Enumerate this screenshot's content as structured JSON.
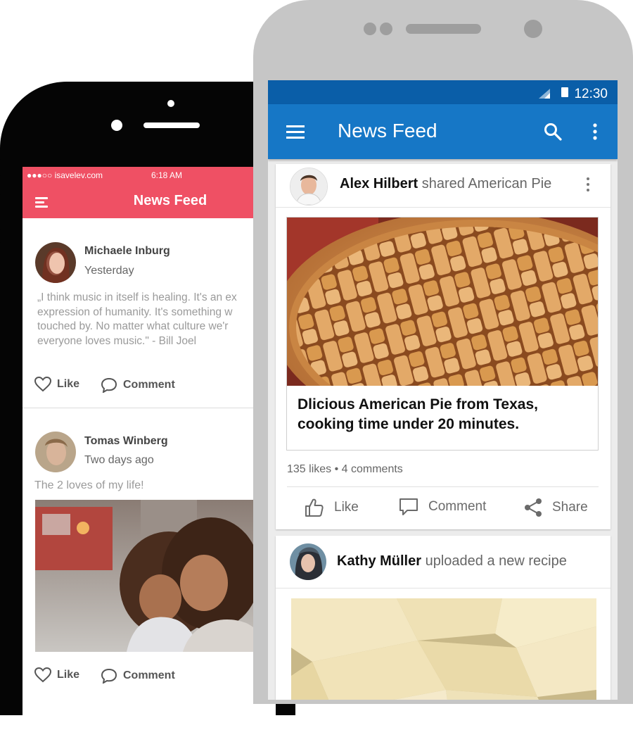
{
  "iphone": {
    "status": {
      "carrier": "●●●○○ isavelev.com",
      "time": "6:18 AM"
    },
    "nav": {
      "title": "News Feed",
      "menu_icon": "hamburger-icon"
    },
    "posts": [
      {
        "author": "Michaele Inburg",
        "time": "Yesterday",
        "text_lines": [
          "„I think music in itself is healing. It's an ex",
          "expression of humanity. It's something w",
          "touched by. No matter what culture we'r",
          "everyone loves music.\" - Bill Joel"
        ],
        "like_label": "Like",
        "comment_label": "Comment"
      },
      {
        "author": "Tomas Winberg",
        "time": "Two days ago",
        "caption": "The 2 loves of my life!",
        "like_label": "Like",
        "comment_label": "Comment"
      }
    ],
    "accent": "#ef5064"
  },
  "android": {
    "status": {
      "time": "12:30"
    },
    "toolbar": {
      "title": "News Feed",
      "menu_icon": "hamburger-icon",
      "search_icon": "search-icon",
      "more_icon": "more-vert-icon"
    },
    "cards": [
      {
        "author": "Alex Hilbert",
        "verb": "shared American Pie",
        "headline": "Dlicious American Pie from Texas, cooking time under 20 minutes.",
        "stats": "135 likes • 4 comments",
        "like_label": "Like",
        "comment_label": "Comment",
        "share_label": "Share"
      },
      {
        "author": "Kathy Müller",
        "verb": "uploaded a new recipe"
      }
    ],
    "colors": {
      "status_bar": "#0a5ea8",
      "toolbar": "#1677c6"
    }
  }
}
